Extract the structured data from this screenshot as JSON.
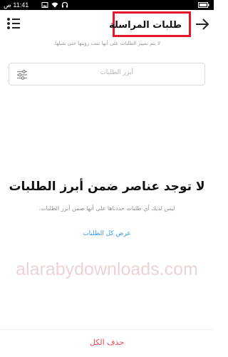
{
  "status_bar": {
    "time": "11:41 ص",
    "icons": [
      "image-icon",
      "wifi-icon",
      "headphones-icon",
      "battery-icon"
    ]
  },
  "header": {
    "title": "طلبات المراسلة",
    "icons": [
      "back-arrow-icon",
      "list-menu-icon"
    ]
  },
  "info_note": "لا يتم تمييز الطلبات على أنها تمت رؤيتها حتى تقبلها.",
  "search": {
    "placeholder": "أبرز الطلبات",
    "icon": "filter-sliders-icon"
  },
  "empty_state": {
    "title": "لا توجد عناصر ضمن أبرز الطلبات",
    "subtitle": "ليس لديك أي طلبات حددناها على أنها ضمن أبرز الطلبات.",
    "link": "عرض كل الطلبات"
  },
  "watermark": "alarabydownloads.com",
  "bottom": {
    "delete_all": "حذف الكل"
  },
  "colors": {
    "highlight_box": "#e3162a",
    "link": "#3897f0",
    "danger": "#ed4956",
    "status_bar": "#000000"
  }
}
